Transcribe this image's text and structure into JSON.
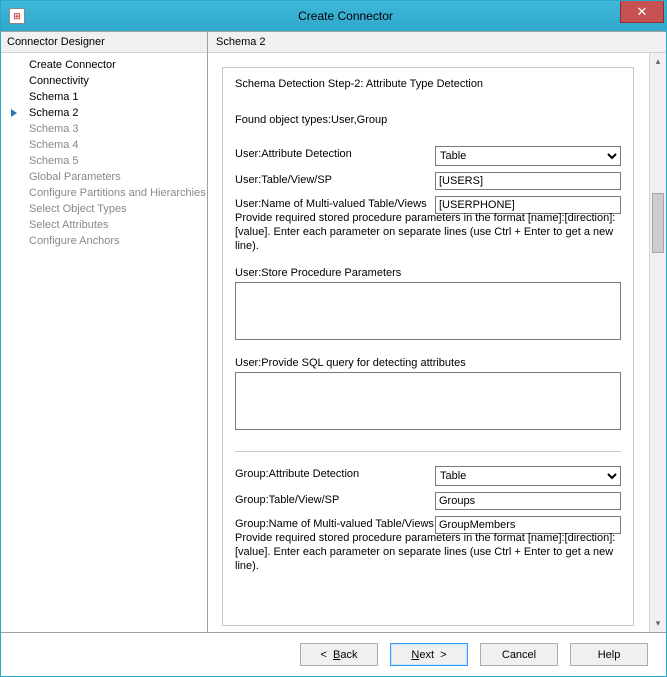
{
  "window": {
    "title": "Create Connector"
  },
  "sidebar": {
    "header": "Connector Designer",
    "items": [
      {
        "label": "Create Connector",
        "kind": "top"
      },
      {
        "label": "Connectivity",
        "kind": "top"
      },
      {
        "label": "Schema 1",
        "kind": "top"
      },
      {
        "label": "Schema 2",
        "kind": "current"
      },
      {
        "label": "Schema 3",
        "kind": "sub"
      },
      {
        "label": "Schema 4",
        "kind": "sub"
      },
      {
        "label": "Schema 5",
        "kind": "sub"
      },
      {
        "label": "Global Parameters",
        "kind": "sub"
      },
      {
        "label": "Configure Partitions and Hierarchies",
        "kind": "sub"
      },
      {
        "label": "Select Object Types",
        "kind": "sub"
      },
      {
        "label": "Select Attributes",
        "kind": "sub"
      },
      {
        "label": "Configure Anchors",
        "kind": "sub"
      }
    ]
  },
  "main": {
    "header": "Schema 2",
    "step_title": "Schema Detection Step-2: Attribute Type Detection",
    "found": "Found object types:User,Group",
    "user": {
      "attr_detection_label": "User:Attribute Detection",
      "attr_detection_value": "Table",
      "tvs_label": "User:Table/View/SP",
      "tvs_value": "[USERS]",
      "mv_label": "User:Name of Multi-valued Table/Views",
      "mv_value": "[USERPHONE]",
      "hint": "Provide required stored procedure parameters in the format [name]:[direction]:[value]. Enter each parameter on separate lines (use Ctrl + Enter to get a new line).",
      "sp_params_label": "User:Store Procedure Parameters",
      "sp_params_value": "",
      "sql_label": "User:Provide SQL query for detecting attributes",
      "sql_value": ""
    },
    "group": {
      "attr_detection_label": "Group:Attribute Detection",
      "attr_detection_value": "Table",
      "tvs_label": "Group:Table/View/SP",
      "tvs_value": "Groups",
      "mv_label": "Group:Name of Multi-valued Table/Views",
      "mv_value": "GroupMembers",
      "hint": "Provide required stored procedure parameters in the format [name]:[direction]:[value]. Enter each parameter on separate lines (use Ctrl + Enter to get a new line)."
    }
  },
  "footer": {
    "back": "Back",
    "next": "Next",
    "cancel": "Cancel",
    "help": "Help"
  }
}
